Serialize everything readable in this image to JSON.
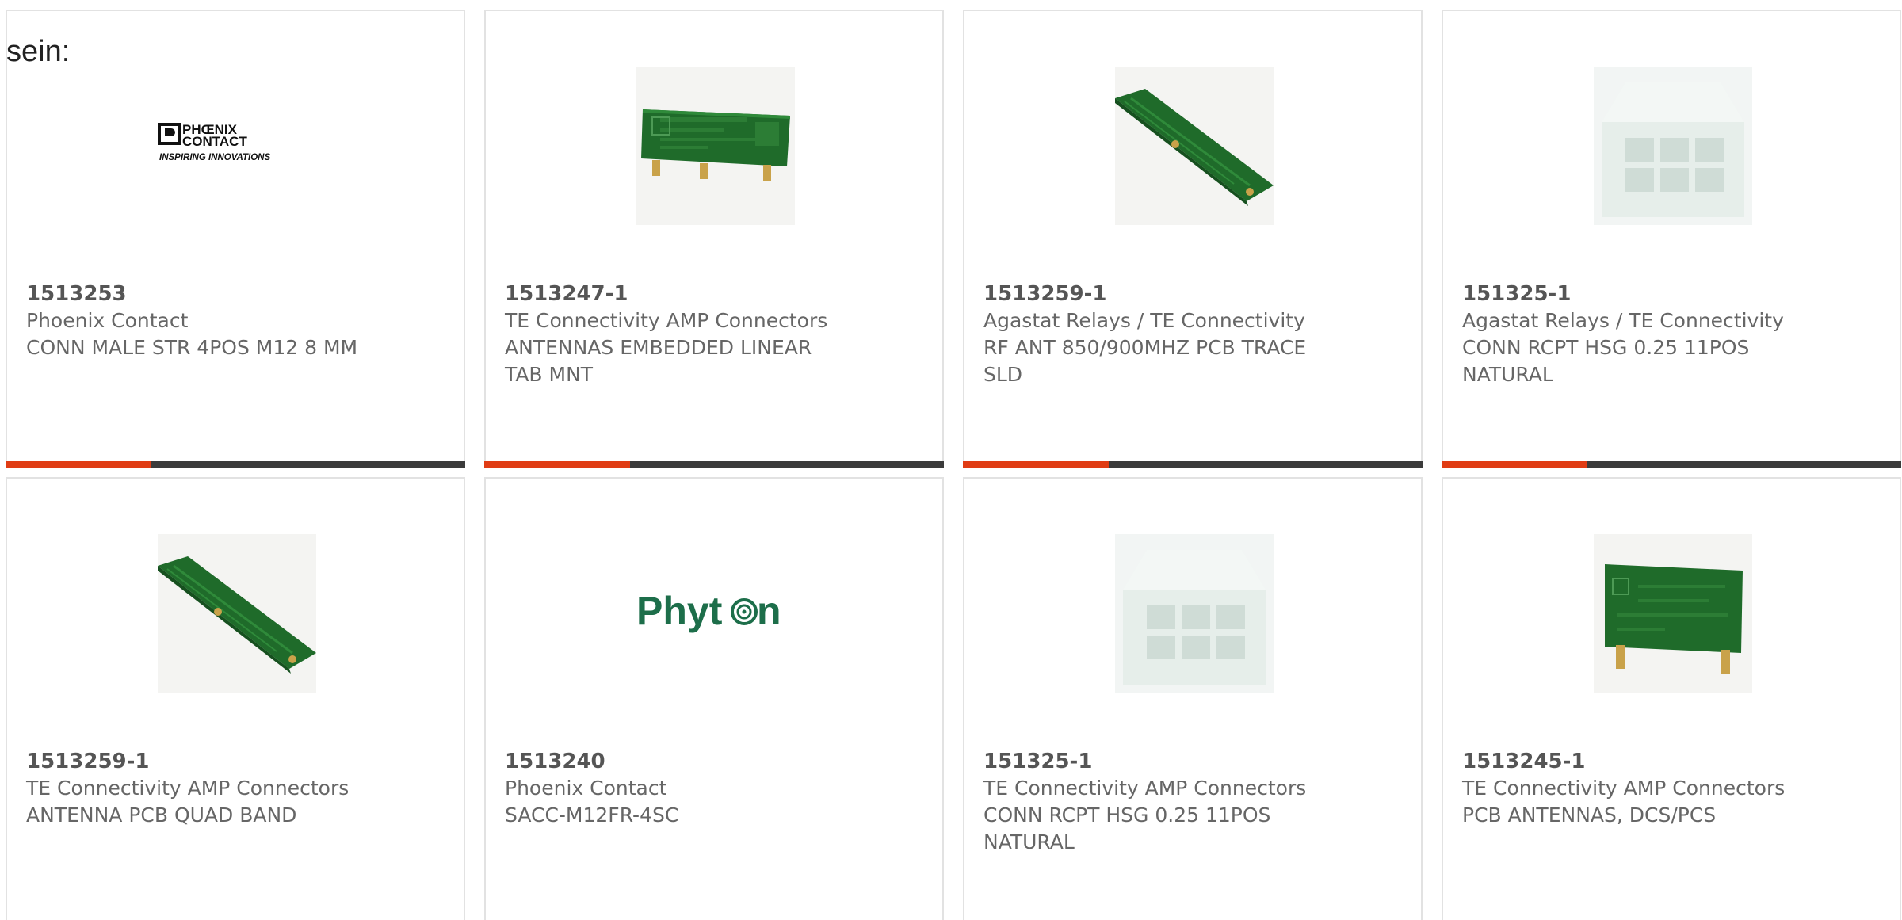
{
  "intro_text": "sein:",
  "colors": {
    "accent": "#e03c14",
    "bar": "#3b3b3b",
    "border": "#e2e2e2",
    "text": "#666666"
  },
  "products": [
    {
      "part_number": "1513253",
      "manufacturer": "Phoenix Contact",
      "description": "CONN MALE STR 4POS M12 8 MM",
      "image": "phoenix-contact-logo",
      "logo_line1": "PHŒNIX",
      "logo_line2": "CONTACT",
      "logo_tagline": "INSPIRING INNOVATIONS",
      "bar": true
    },
    {
      "part_number": "1513247-1",
      "manufacturer": "TE Connectivity AMP Connectors",
      "description": "ANTENNAS EMBEDDED LINEAR TAB MNT",
      "image": "pcb-antenna-tab",
      "bar": true
    },
    {
      "part_number": "1513259-1",
      "manufacturer": "Agastat Relays / TE Connectivity",
      "description": "RF ANT 850/900MHZ PCB TRACE SLD",
      "image": "pcb-antenna-diagonal",
      "bar": true
    },
    {
      "part_number": "151325-1",
      "manufacturer": "Agastat Relays / TE Connectivity",
      "description": "CONN RCPT HSG 0.25 11POS NATURAL",
      "image": "connector-housing",
      "bar": true
    },
    {
      "part_number": "1513259-1",
      "manufacturer": "TE Connectivity AMP Connectors",
      "description": "ANTENNA PCB QUAD BAND",
      "image": "pcb-antenna-diagonal",
      "bar": false
    },
    {
      "part_number": "1513240",
      "manufacturer": "Phoenix Contact",
      "description": "SACC-M12FR-4SC",
      "image": "phyton-logo",
      "logo_text": "Phyt",
      "logo_text_end": "n",
      "bar": false
    },
    {
      "part_number": "151325-1",
      "manufacturer": "TE Connectivity AMP Connectors",
      "description": "CONN RCPT HSG 0.25 11POS NATURAL",
      "image": "connector-housing",
      "bar": false
    },
    {
      "part_number": "1513245-1",
      "manufacturer": "TE Connectivity AMP Connectors",
      "description": "PCB ANTENNAS, DCS/PCS",
      "image": "pcb-antenna-upright",
      "bar": false
    }
  ]
}
